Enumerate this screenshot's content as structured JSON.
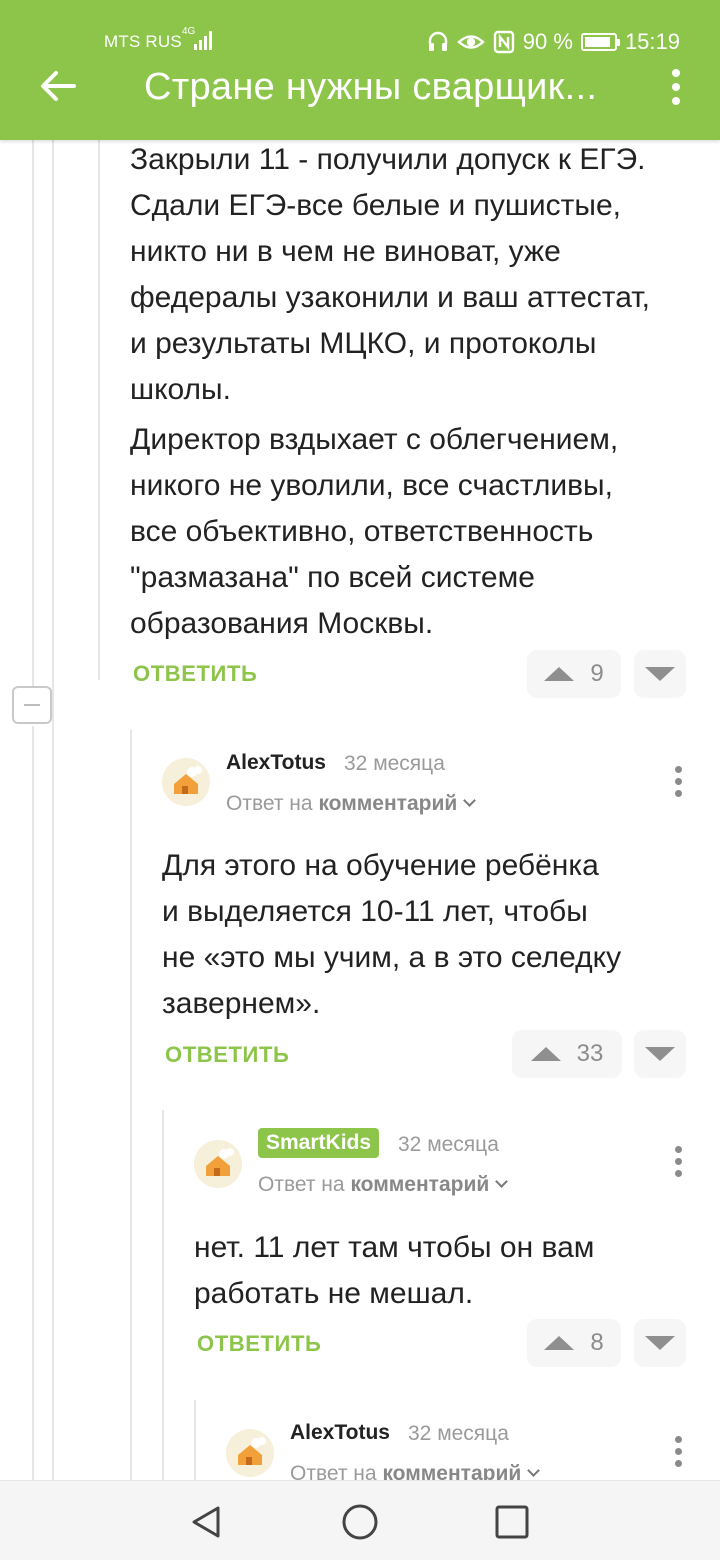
{
  "status_bar": {
    "carrier": "MTS RUS",
    "network": "4G",
    "battery": "90 %",
    "battery_level": 0.9,
    "time": "15:19"
  },
  "toolbar": {
    "title": "Стране нужны сварщик..."
  },
  "comments": [
    {
      "lines": [
        "Закрыли 11 - получили допуск к ЕГЭ.",
        "Сдали ЕГЭ-все белые и пушистые,",
        "никто ни в чем не виноват, уже",
        "федералы узаконили и ваш аттестат,",
        "и результаты МЦКО, и протоколы",
        "школы.",
        "Директор вздыхает с облегчением,",
        "никого не уволили, все счастливы,",
        "все объективно, ответственность",
        "\"размазана\" по всей системе",
        "образования Москвы."
      ],
      "reply_label": "ОТВЕТИТЬ",
      "votes": "9"
    },
    {
      "author": "AlexTotus",
      "time": "32 месяца",
      "reply_to_prefix": "Ответ на",
      "reply_to_target": "комментарий",
      "lines": [
        "Для этого на обучение ребёнка",
        "и выделяется 10-11 лет, чтобы",
        "не «это мы учим, а в это селедку",
        "завернем»."
      ],
      "reply_label": "ОТВЕТИТЬ",
      "votes": "33"
    },
    {
      "author": "SmartKids",
      "time": "32 месяца",
      "reply_to_prefix": "Ответ на",
      "reply_to_target": "комментарий",
      "lines": [
        "нет. 11 лет там чтобы он вам",
        "работать не мешал."
      ],
      "reply_label": "ОТВЕТИТЬ",
      "votes": "8"
    },
    {
      "author": "AlexTotus",
      "time": "32 месяца",
      "reply_to_prefix": "Ответ на",
      "reply_to_target": "комментарий"
    }
  ],
  "colors": {
    "brand_green": "#8dc54b",
    "text": "#222222",
    "muted": "#9a9a9a"
  },
  "icons": {
    "back": "arrow-left-icon",
    "more": "more-vertical-icon",
    "nav_back": "triangle-back-icon",
    "nav_home": "circle-home-icon",
    "nav_recents": "square-recents-icon"
  }
}
